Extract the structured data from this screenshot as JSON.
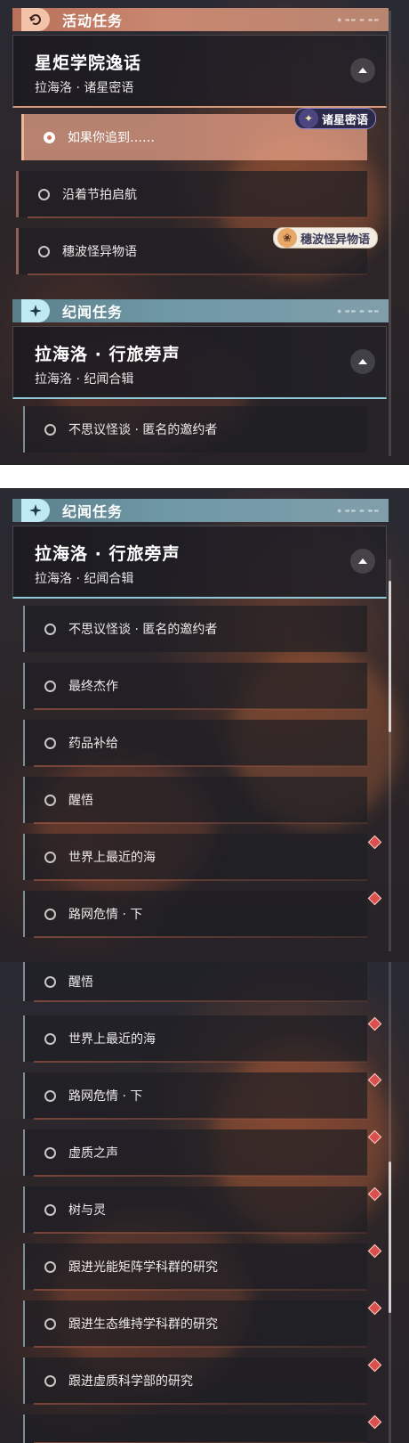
{
  "colors": {
    "activity_accent": "#c98770",
    "story_accent": "#6f98a6",
    "alert_diamond": "#d9504e"
  },
  "panel1": {
    "activity_header": {
      "title": "活动任务",
      "icon": "activity-quest-icon"
    },
    "activity_card": {
      "title": "星炬学院逸话",
      "subtitle": "拉海洛 · 诸星密语",
      "toggle_icon": "collapse-arrow-icon"
    },
    "star_tag": {
      "label": "诸星密语",
      "icon": "star-compass-icon"
    },
    "wave_tag": {
      "label": "穗波怪异物语",
      "icon": "fox-mascot-icon"
    },
    "activity_items": [
      {
        "label": "如果你追到……",
        "selected": true
      },
      {
        "label": "沿着节拍启航",
        "selected": false
      },
      {
        "label": "穗波怪异物语",
        "selected": false
      }
    ],
    "story_header": {
      "title": "纪闻任务",
      "icon": "sparkle-icon"
    },
    "story_card": {
      "title": "拉海洛 · 行旅旁声",
      "subtitle": "拉海洛 · 纪闻合辑",
      "toggle_icon": "collapse-arrow-icon"
    },
    "story_items": [
      {
        "label": "不思议怪谈 · 匿名的邀约者"
      }
    ]
  },
  "panel2": {
    "story_header": {
      "title": "纪闻任务",
      "icon": "sparkle-icon"
    },
    "story_card": {
      "title": "拉海洛 · 行旅旁声",
      "subtitle": "拉海洛 · 纪闻合辑",
      "toggle_icon": "collapse-arrow-icon"
    },
    "items": [
      {
        "label": "不思议怪谈 · 匿名的邀约者",
        "alert": false
      },
      {
        "label": "最终杰作",
        "alert": false
      },
      {
        "label": "药品补给",
        "alert": false
      },
      {
        "label": "醒悟",
        "alert": true
      },
      {
        "label": "世界上最近的海",
        "alert": true
      },
      {
        "label": "路网危情 · 下",
        "alert": false
      }
    ]
  },
  "panel3": {
    "items": [
      {
        "label": "醒悟",
        "alert": true
      },
      {
        "label": "世界上最近的海",
        "alert": true
      },
      {
        "label": "路网危情 · 下",
        "alert": true
      },
      {
        "label": "虚质之声",
        "alert": true
      },
      {
        "label": "树与灵",
        "alert": true
      },
      {
        "label": "跟进光能矩阵学科群的研究",
        "alert": true
      },
      {
        "label": "跟进生态维持学科群的研究",
        "alert": true
      },
      {
        "label": "跟进虚质科学部的研究",
        "alert": true
      }
    ]
  }
}
